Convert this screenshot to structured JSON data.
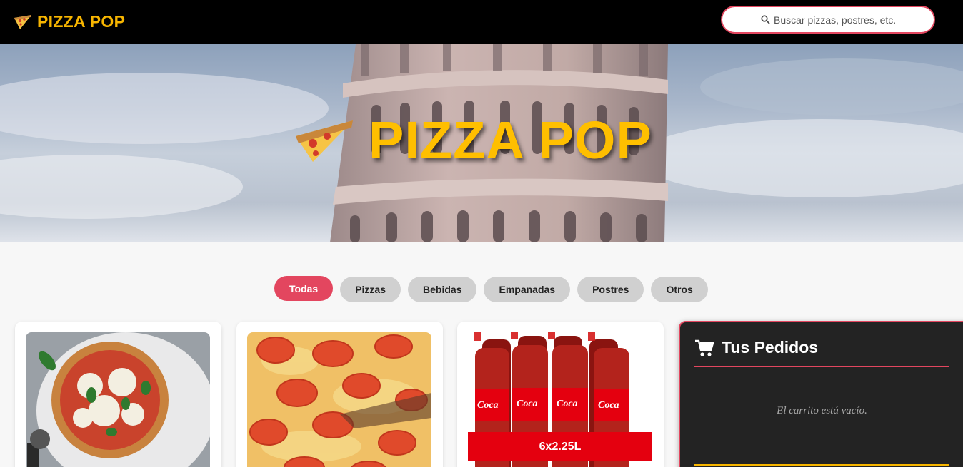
{
  "header": {
    "brand": "PIZZA POP",
    "logo_icon": "pizza-slice-icon",
    "search": {
      "placeholder": "Buscar pizzas, postres, etc.",
      "icon": "search-icon"
    }
  },
  "hero": {
    "title": "PIZZA POP",
    "icon": "pizza-slice-icon"
  },
  "categories": [
    {
      "label": "Todas",
      "active": true
    },
    {
      "label": "Pizzas",
      "active": false
    },
    {
      "label": "Bebidas",
      "active": false
    },
    {
      "label": "Empanadas",
      "active": false
    },
    {
      "label": "Postres",
      "active": false
    },
    {
      "label": "Otros",
      "active": false
    }
  ],
  "products": [
    {
      "image": "pizza-margherita-photo"
    },
    {
      "image": "pizza-tomato-photo"
    },
    {
      "image": "coca-cola-pack-photo",
      "image_text": "6x2.25L"
    }
  ],
  "cart": {
    "title": "Tus Pedidos",
    "icon": "shopping-cart-icon",
    "empty_message": "El carrito está vacío."
  },
  "colors": {
    "accent": "#e3465f",
    "brand": "#f7b500",
    "header_bg": "#000000",
    "cart_bg": "#232323"
  }
}
